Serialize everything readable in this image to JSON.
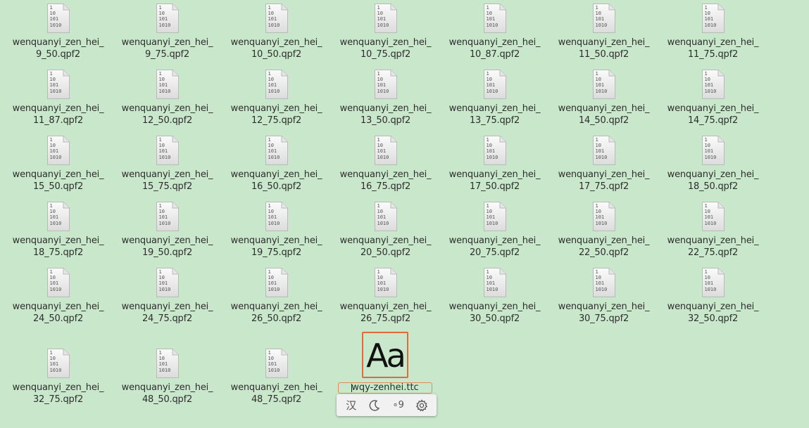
{
  "files": [
    {
      "line1": "wenquanyi_zen_hei_",
      "line2": "9_50.qpf2"
    },
    {
      "line1": "wenquanyi_zen_hei_",
      "line2": "9_75.qpf2"
    },
    {
      "line1": "wenquanyi_zen_hei_",
      "line2": "10_50.qpf2"
    },
    {
      "line1": "wenquanyi_zen_hei_",
      "line2": "10_75.qpf2"
    },
    {
      "line1": "wenquanyi_zen_hei_",
      "line2": "10_87.qpf2"
    },
    {
      "line1": "wenquanyi_zen_hei_",
      "line2": "11_50.qpf2"
    },
    {
      "line1": "wenquanyi_zen_hei_",
      "line2": "11_75.qpf2"
    },
    {
      "line1": "wenquanyi_zen_hei_",
      "line2": "11_87.qpf2"
    },
    {
      "line1": "wenquanyi_zen_hei_",
      "line2": "12_50.qpf2"
    },
    {
      "line1": "wenquanyi_zen_hei_",
      "line2": "12_75.qpf2"
    },
    {
      "line1": "wenquanyi_zen_hei_",
      "line2": "13_50.qpf2"
    },
    {
      "line1": "wenquanyi_zen_hei_",
      "line2": "13_75.qpf2"
    },
    {
      "line1": "wenquanyi_zen_hei_",
      "line2": "14_50.qpf2"
    },
    {
      "line1": "wenquanyi_zen_hei_",
      "line2": "14_75.qpf2"
    },
    {
      "line1": "wenquanyi_zen_hei_",
      "line2": "15_50.qpf2"
    },
    {
      "line1": "wenquanyi_zen_hei_",
      "line2": "15_75.qpf2"
    },
    {
      "line1": "wenquanyi_zen_hei_",
      "line2": "16_50.qpf2"
    },
    {
      "line1": "wenquanyi_zen_hei_",
      "line2": "16_75.qpf2"
    },
    {
      "line1": "wenquanyi_zen_hei_",
      "line2": "17_50.qpf2"
    },
    {
      "line1": "wenquanyi_zen_hei_",
      "line2": "17_75.qpf2"
    },
    {
      "line1": "wenquanyi_zen_hei_",
      "line2": "18_50.qpf2"
    },
    {
      "line1": "wenquanyi_zen_hei_",
      "line2": "18_75.qpf2"
    },
    {
      "line1": "wenquanyi_zen_hei_",
      "line2": "19_50.qpf2"
    },
    {
      "line1": "wenquanyi_zen_hei_",
      "line2": "19_75.qpf2"
    },
    {
      "line1": "wenquanyi_zen_hei_",
      "line2": "20_50.qpf2"
    },
    {
      "line1": "wenquanyi_zen_hei_",
      "line2": "20_75.qpf2"
    },
    {
      "line1": "wenquanyi_zen_hei_",
      "line2": "22_50.qpf2"
    },
    {
      "line1": "wenquanyi_zen_hei_",
      "line2": "22_75.qpf2"
    },
    {
      "line1": "wenquanyi_zen_hei_",
      "line2": "24_50.qpf2"
    },
    {
      "line1": "wenquanyi_zen_hei_",
      "line2": "24_75.qpf2"
    },
    {
      "line1": "wenquanyi_zen_hei_",
      "line2": "26_50.qpf2"
    },
    {
      "line1": "wenquanyi_zen_hei_",
      "line2": "26_75.qpf2"
    },
    {
      "line1": "wenquanyi_zen_hei_",
      "line2": "30_50.qpf2"
    },
    {
      "line1": "wenquanyi_zen_hei_",
      "line2": "30_75.qpf2"
    },
    {
      "line1": "wenquanyi_zen_hei_",
      "line2": "32_50.qpf2"
    },
    {
      "line1": "wenquanyi_zen_hei_",
      "line2": "32_75.qpf2"
    },
    {
      "line1": "wenquanyi_zen_hei_",
      "line2": "48_50.qpf2"
    },
    {
      "line1": "wenquanyi_zen_hei_",
      "line2": "48_75.qpf2"
    }
  ],
  "binary_icon_text": "1\n10\n101\n1010",
  "selected_font": {
    "preview": "Aa",
    "rename_value": "wqy-zenhei.ttc"
  },
  "ime_panel": {
    "chinese_mode": "汉",
    "punct_icon": "moon-icon",
    "full_half_width": "∘9",
    "settings_icon": "gear-icon"
  },
  "colors": {
    "desktop_bg": "#c9e7cb",
    "selection_border": "#e06a3c"
  }
}
